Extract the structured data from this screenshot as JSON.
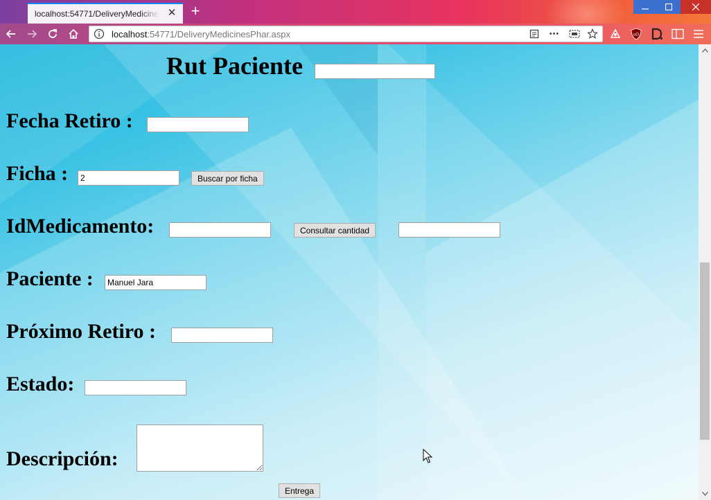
{
  "browser": {
    "tab_title": "localhost:54771/DeliveryMedicinesPhar.aspx",
    "url_host": "localhost",
    "url_rest": ":54771/DeliveryMedicinesPhar.aspx",
    "tab_close": "✕",
    "new_tab": "+",
    "more_actions": "•••"
  },
  "form": {
    "rut_label": "Rut Paciente",
    "rut_value": "",
    "fecha_label": "Fecha Retiro :",
    "fecha_value": "",
    "ficha_label": "Ficha :",
    "ficha_value": "2",
    "buscar_button": "Buscar por ficha",
    "idmed_label": "IdMedicamento:",
    "idmed_value": "",
    "consultar_button": "Consultar cantidad",
    "cantidad_value": "",
    "paciente_label": "Paciente :",
    "paciente_value": "Manuel Jara",
    "proximo_label": "Próximo Retiro :",
    "proximo_value": "",
    "estado_label": "Estado:",
    "estado_value": "",
    "descripcion_label": "Descripción:",
    "descripcion_value": "",
    "entrega_button": "Entrega"
  },
  "colors": {
    "accent_tab": "#0a84ff",
    "button_bg": "#e1e1e1",
    "close_btn": "#c7312a"
  }
}
